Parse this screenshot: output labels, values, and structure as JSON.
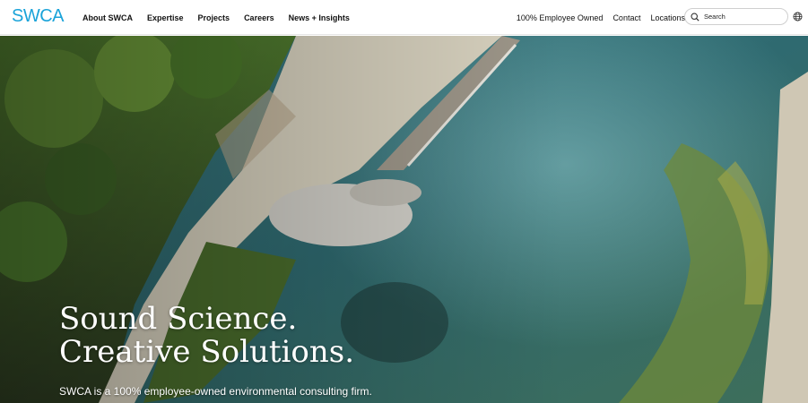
{
  "brand": {
    "logo_text": "SWCA",
    "logo_color": "#1aa3d9"
  },
  "nav": {
    "primary": [
      {
        "label": "About SWCA"
      },
      {
        "label": "Expertise"
      },
      {
        "label": "Projects"
      },
      {
        "label": "Careers"
      },
      {
        "label": "News + Insights"
      }
    ],
    "secondary": [
      {
        "label": "100% Employee Owned"
      },
      {
        "label": "Contact"
      },
      {
        "label": "Locations"
      }
    ]
  },
  "search": {
    "placeholder": "Search",
    "icon": "search-icon"
  },
  "language": {
    "icon": "globe-icon"
  },
  "hero": {
    "headline_line1": "Sound Science.",
    "headline_line2": "Creative Solutions.",
    "tagline": "SWCA is a 100% employee-owned environmental consulting firm.",
    "image": "aerial-river-photo"
  },
  "colors": {
    "header_bg": "#ffffff",
    "text_dark": "#111111",
    "hero_text": "#ffffff"
  }
}
